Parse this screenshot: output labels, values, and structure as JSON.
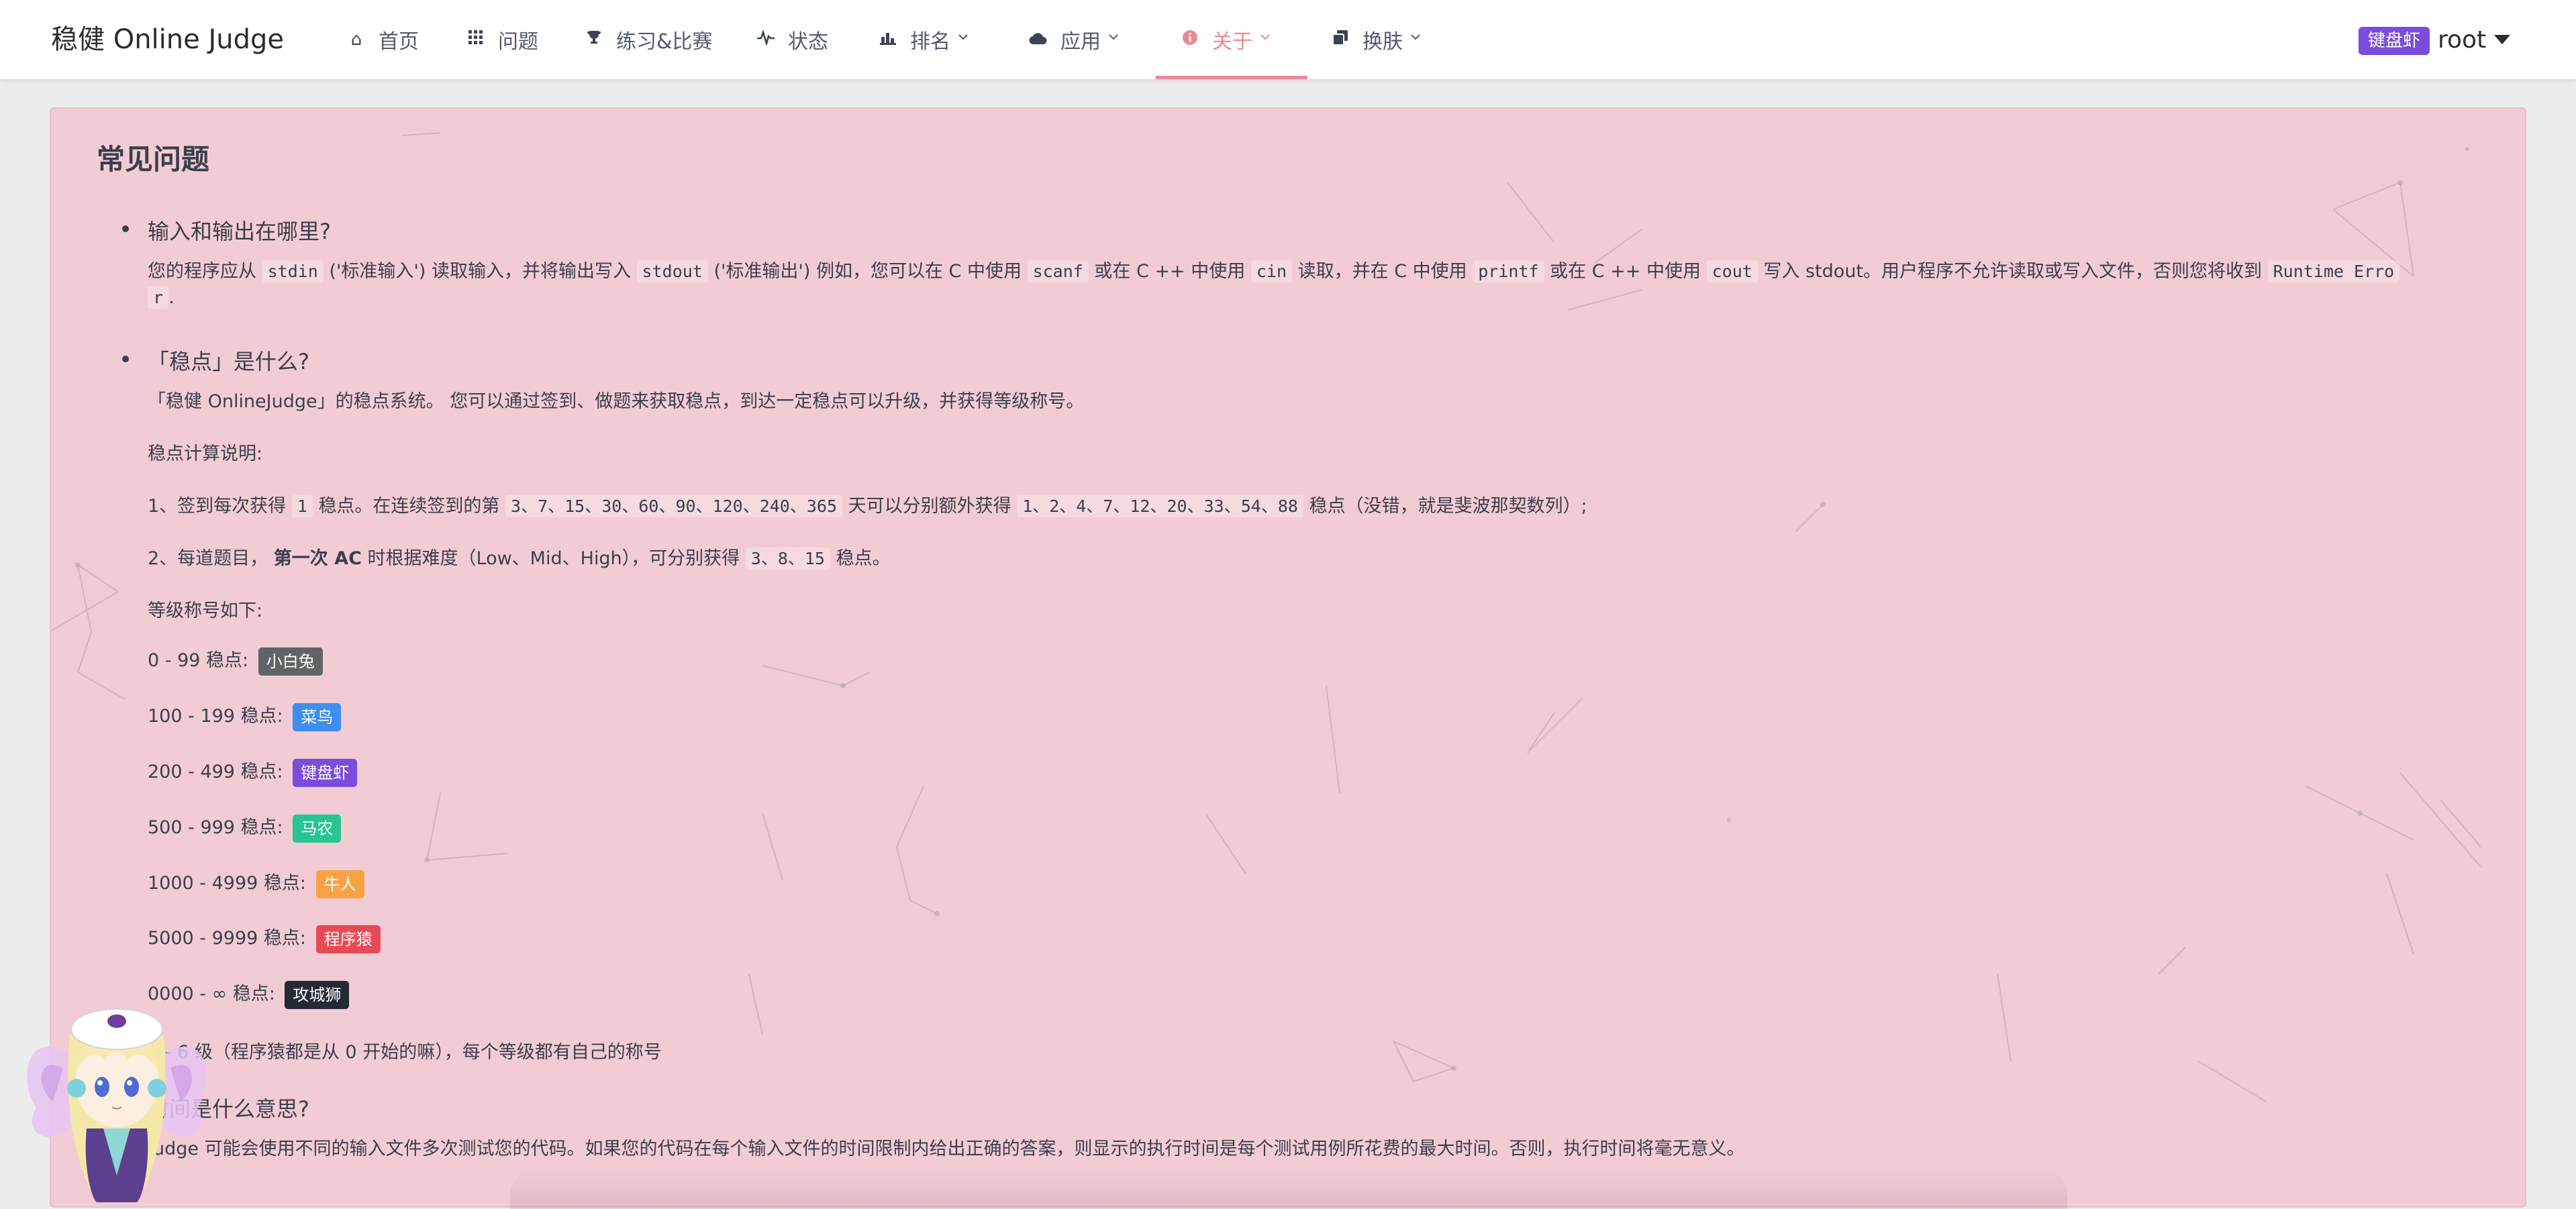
{
  "brand": "稳健 Online Judge",
  "nav": {
    "home": "首页",
    "problems": "问题",
    "contests": "练习&比赛",
    "status": "状态",
    "rank": "排名",
    "apps": "应用",
    "about": "关于",
    "skin": "换肤"
  },
  "user": {
    "badge": "键盘虾",
    "name": "root"
  },
  "colors": {
    "accent": "#ec8898",
    "card_bg": "#f2ccd4",
    "level_rabbit": "#5f6466",
    "level_rookie": "#3e8ef0",
    "level_keyboard": "#7b4ddc",
    "level_farmer": "#27c591",
    "level_expert": "#f7a245",
    "level_monkey": "#e84a55",
    "level_lion": "#242a33"
  },
  "faq": {
    "title": "常见问题",
    "q1": {
      "title": "输入和输出在哪里?",
      "p1": "您的程序应从",
      "c1": "stdin",
      "p2": "('标准输入') 读取输入，并将输出写入",
      "c2": "stdout",
      "p3": "('标准输出') 例如，您可以在 C 中使用",
      "c3": "scanf",
      "p4": "或在 C ++ 中使用",
      "c4": "cin",
      "p5": "读取，并在 C 中使用",
      "c5": "printf",
      "p6": "或在 C ++ 中使用",
      "c6": "cout",
      "p7": "写入 stdout。用户程序不允许读取或写入文件，否则您将收到",
      "c7a": "Runtime Erro",
      "c7b": "r",
      "p8": "."
    },
    "q2": {
      "title": "「稳点」是什么?",
      "intro": "「稳健 OnlineJudge」的稳点系统。 您可以通过签到、做题来获取稳点，到达一定稳点可以升级，并获得等级称号。",
      "calc_title": "稳点计算说明:",
      "r1_a": "1、签到每次获得",
      "r1_c1": "1",
      "r1_b": "稳点。在连续签到的第",
      "r1_c2": "3、7、15、30、60、90、120、240、365",
      "r1_c": "天可以分别额外获得",
      "r1_c3": "1、2、4、7、12、20、33、54、88",
      "r1_d": "稳点（没错，就是斐波那契数列）;",
      "r2_a": "2、每道题目，",
      "r2_bold": "第一次 AC",
      "r2_b": "时根据难度（Low、Mid、High），可分别获得",
      "r2_c1": "3、8、15",
      "r2_c": "稳点。",
      "levels_title": "等级称号如下:",
      "levels": [
        {
          "range": "0 - 99 稳点:",
          "name": "小白兔"
        },
        {
          "range": "100 - 199 稳点:",
          "name": "菜鸟"
        },
        {
          "range": "200 - 499 稳点:",
          "name": "键盘虾"
        },
        {
          "range": "500 - 999 稳点:",
          "name": "马农"
        },
        {
          "range": "1000 - 4999 稳点:",
          "name": "牛人"
        },
        {
          "range": "5000 - 9999 稳点:",
          "name": "程序猿"
        },
        {
          "range": "0000 - ∞ 稳点:",
          "name": "攻城狮"
        }
      ],
      "levels_note": "0 - 6 级（程序猿都是从 0 开始的嘛），每个等级都有自己的称号"
    },
    "q3": {
      "title": "时间是什么意思?",
      "text": "Judge 可能会使用不同的输入文件多次测试您的代码。如果您的代码在每个输入文件的时间限制内给出正确的答案，则显示的执行时间是每个测试用例所花费的最大时间。否则，执行时间将毫无意义。"
    }
  }
}
